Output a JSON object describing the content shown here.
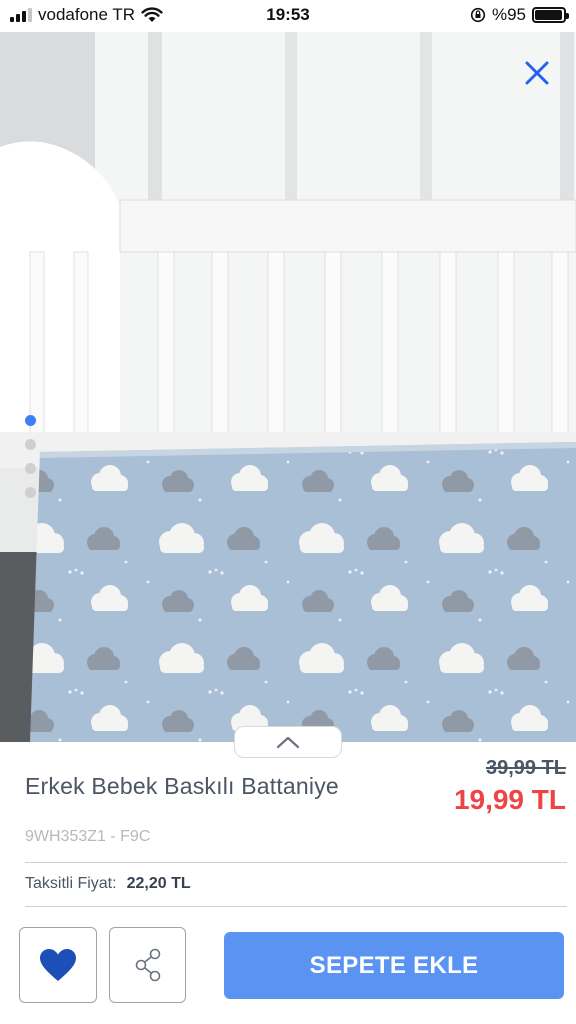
{
  "status_bar": {
    "carrier": "vodafone TR",
    "time": "19:53",
    "battery_text": "%95",
    "battery_level": 0.95
  },
  "gallery": {
    "image_count": 4,
    "active_index": 0,
    "close_icon": "close-icon",
    "expand_icon": "chevron-up-icon"
  },
  "product": {
    "title": "Erkek Bebek Baskılı Battaniye",
    "old_price": "39,99 TL",
    "new_price": "19,99 TL",
    "sku": "9WH353Z1 - F9C",
    "installment_label": "Taksitli Fiyat:",
    "installment_price": "22,20 TL"
  },
  "actions": {
    "favorite_icon": "heart-icon",
    "share_icon": "share-icon",
    "add_to_cart_label": "SEPETE EKLE"
  },
  "colors": {
    "accent": "#5b93f3",
    "price_red": "#ef4444",
    "heart_blue": "#1d4fb8",
    "close_blue": "#2563eb"
  }
}
